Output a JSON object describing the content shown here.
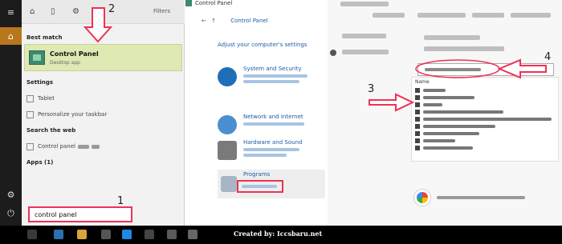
{
  "start_menu": {
    "filters_label": "Filters",
    "sections": {
      "best_match": "Best match",
      "settings": "Settings",
      "search_web": "Search the web",
      "apps": "Apps (1)"
    },
    "best_match_item": {
      "title": "Control Panel",
      "subtitle": "Desktop app"
    },
    "settings_items": [
      "Tablet",
      "Personalize your taskbar"
    ],
    "web_item": "Control panel",
    "search_query": "control panel"
  },
  "control_panel": {
    "title": "Control Panel",
    "breadcrumb": "Control Panel",
    "heading": "Adjust your computer's settings",
    "categories": [
      {
        "title": "System and Security"
      },
      {
        "title": "Network and Internet"
      },
      {
        "title": "Hardware and Sound"
      },
      {
        "title": "Programs"
      }
    ]
  },
  "programs_panel": {
    "column_header": "Name"
  },
  "annotations": {
    "step1": "1",
    "step2": "2",
    "step3": "3",
    "step4": "4"
  },
  "credit": "Created by: Iccsbaru.net",
  "colors": {
    "highlight": "#ee3255",
    "best_match_bg": "#dfe9b4",
    "rail_bg": "#1c1c1c",
    "taskbar_bg": "#000000"
  }
}
